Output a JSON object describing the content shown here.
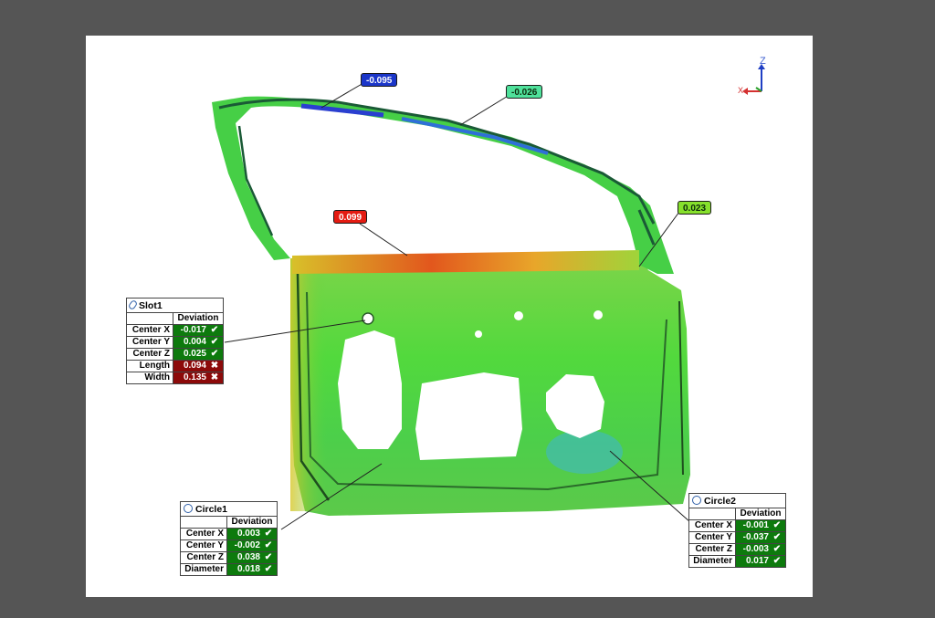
{
  "callouts": [
    {
      "value": "-0.095",
      "color": "#1b36c9"
    },
    {
      "value": "-0.026",
      "color": "#4fe19b"
    },
    {
      "value": "0.099",
      "color": "#e41b12"
    },
    {
      "value": "0.023",
      "color": "#86e02c"
    }
  ],
  "axis": {
    "z": "Z",
    "x": "X"
  },
  "column_header": "Deviation",
  "slot1": {
    "title": "Slot1",
    "rows": [
      {
        "label": "Center X",
        "value": "-0.017",
        "status": "pass"
      },
      {
        "label": "Center Y",
        "value": "0.004",
        "status": "pass"
      },
      {
        "label": "Center Z",
        "value": "0.025",
        "status": "pass"
      },
      {
        "label": "Length",
        "value": "0.094",
        "status": "fail"
      },
      {
        "label": "Width",
        "value": "0.135",
        "status": "fail"
      }
    ]
  },
  "circle1": {
    "title": "Circle1",
    "rows": [
      {
        "label": "Center X",
        "value": "0.003",
        "status": "pass"
      },
      {
        "label": "Center Y",
        "value": "-0.002",
        "status": "pass"
      },
      {
        "label": "Center Z",
        "value": "0.038",
        "status": "pass"
      },
      {
        "label": "Diameter",
        "value": "0.018",
        "status": "pass"
      }
    ]
  },
  "circle2": {
    "title": "Circle2",
    "rows": [
      {
        "label": "Center X",
        "value": "-0.001",
        "status": "pass"
      },
      {
        "label": "Center Y",
        "value": "-0.037",
        "status": "pass"
      },
      {
        "label": "Center Z",
        "value": "-0.003",
        "status": "pass"
      },
      {
        "label": "Diameter",
        "value": "0.017",
        "status": "pass"
      }
    ]
  },
  "colors": {
    "pass": "#0d7a0d",
    "fail": "#8c0a0a",
    "background": "#555555"
  },
  "icons": {
    "pass": "check-icon",
    "fail": "cross-icon",
    "slot": "slot-icon",
    "circle": "circle-icon"
  }
}
